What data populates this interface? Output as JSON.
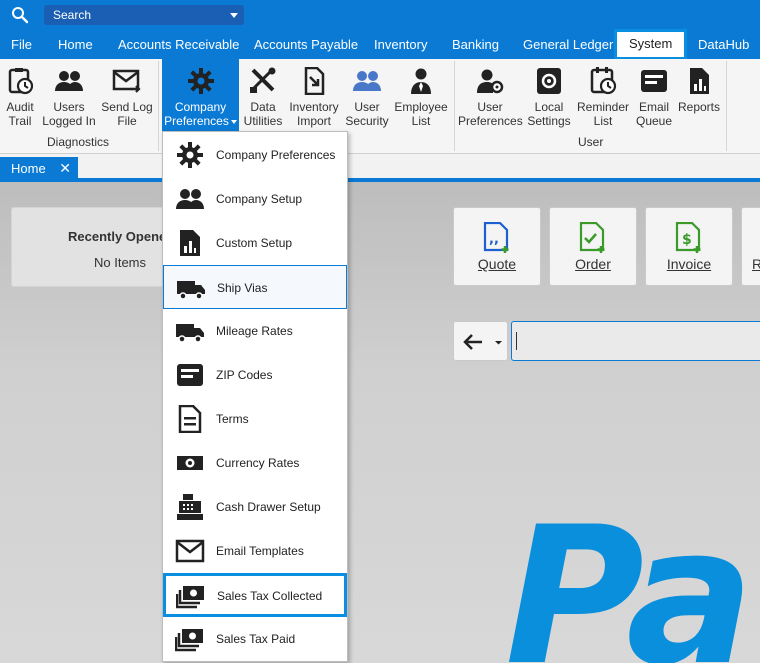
{
  "search": {
    "placeholder": "Search"
  },
  "menu": {
    "tabs": [
      "File",
      "Home",
      "Accounts Receivable",
      "Accounts Payable",
      "Inventory",
      "Banking",
      "General Ledger",
      "System",
      "DataHub"
    ],
    "active": "System"
  },
  "ribbon": {
    "diagnostics": {
      "label": "Diagnostics",
      "buttons": [
        {
          "l1": "Audit",
          "l2": "Trail",
          "icon": "audit-clock-icon"
        },
        {
          "l1": "Users",
          "l2": "Logged In",
          "icon": "users-icon"
        },
        {
          "l1": "Send Log",
          "l2": "File",
          "icon": "envelope-arrow-icon"
        }
      ]
    },
    "company": {
      "buttons": [
        {
          "l1": "Company",
          "l2": "Preferences",
          "icon": "gear-icon"
        },
        {
          "l1": "Data",
          "l2": "Utilities",
          "icon": "tools-icon"
        },
        {
          "l1": "Inventory",
          "l2": "Import",
          "icon": "import-document-icon"
        },
        {
          "l1": "User",
          "l2": "Security",
          "icon": "user-security-icon"
        },
        {
          "l1": "Employee",
          "l2": "List",
          "icon": "employee-icon"
        }
      ]
    },
    "user": {
      "label": "User",
      "buttons": [
        {
          "l1": "User",
          "l2": "Preferences",
          "icon": "user-gear-icon"
        },
        {
          "l1": "Local",
          "l2": "Settings",
          "icon": "settings-gear-icon"
        },
        {
          "l1": "Reminder",
          "l2": "List",
          "icon": "reminder-clock-icon"
        },
        {
          "l1": "Email",
          "l2": "Queue",
          "icon": "email-queue-icon"
        },
        {
          "l1": "Reports",
          "l2": "",
          "icon": "reports-icon"
        }
      ]
    }
  },
  "doc_tab": {
    "label": "Home",
    "close": "✕"
  },
  "recent": {
    "title": "Recently Opened",
    "empty": "No Items"
  },
  "quick_actions": [
    {
      "label": "Quote",
      "color": "#1e5fd0"
    },
    {
      "label": "Order",
      "color": "#3a9a2a"
    },
    {
      "label": "Invoice",
      "color": "#3a9a2a"
    },
    {
      "label": "R"
    }
  ],
  "brand_text": "Pa",
  "dropdown": {
    "items": [
      {
        "label": "Company Preferences",
        "icon": "gear-icon"
      },
      {
        "label": "Company Setup",
        "icon": "people-icon"
      },
      {
        "label": "Custom Setup",
        "icon": "chart-document-icon"
      },
      {
        "label": "Ship Vias",
        "icon": "truck-icon",
        "state": "hover"
      },
      {
        "label": "Mileage Rates",
        "icon": "truck-icon"
      },
      {
        "label": "ZIP Codes",
        "icon": "zip-card-icon"
      },
      {
        "label": "Terms",
        "icon": "document-icon"
      },
      {
        "label": "Currency Rates",
        "icon": "banknote-icon"
      },
      {
        "label": "Cash Drawer Setup",
        "icon": "cash-register-icon"
      },
      {
        "label": "Email Templates",
        "icon": "envelope-icon"
      },
      {
        "label": "Sales Tax Collected",
        "icon": "money-stack-icon",
        "state": "selected"
      },
      {
        "label": "Sales Tax Paid",
        "icon": "money-stack-icon"
      }
    ]
  },
  "colors": {
    "accent": "#0a7ad4",
    "highlight": "#0a8fe0",
    "brand": "#0a8fdc"
  }
}
